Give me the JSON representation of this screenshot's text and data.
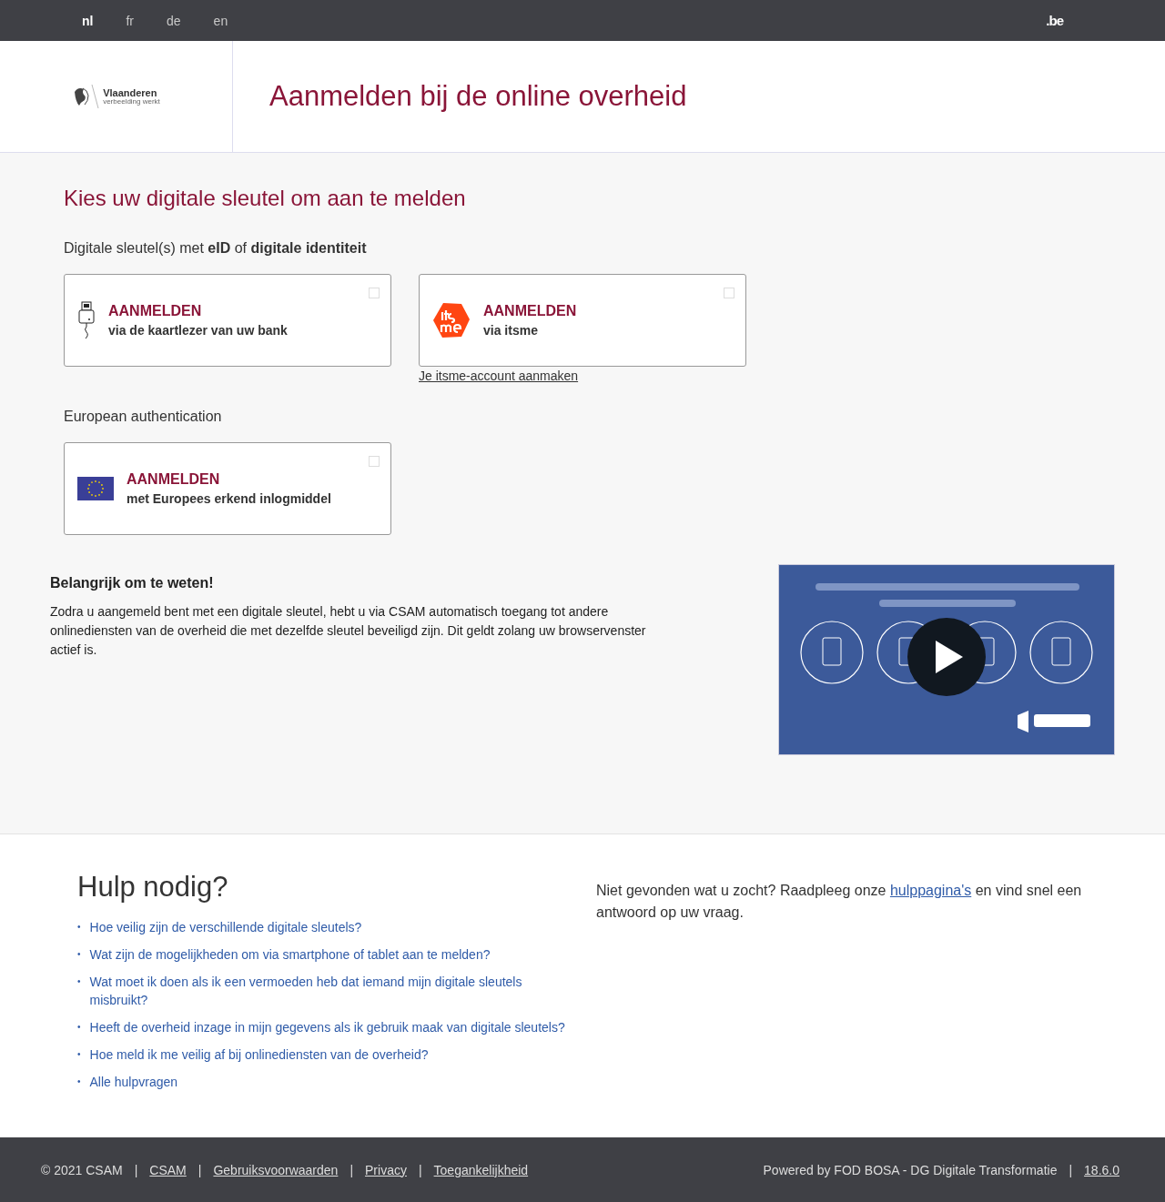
{
  "languages": [
    {
      "label": "nl",
      "selected": true
    },
    {
      "label": "fr",
      "selected": false
    },
    {
      "label": "de",
      "selected": false
    },
    {
      "label": "en",
      "selected": false
    }
  ],
  "domain": ".be",
  "logo": {
    "name": "Vlaanderen",
    "tagline": "verbeelding werkt"
  },
  "page_title": "Aanmelden bij de online overheid",
  "section_title": "Kies uw digitale sleutel om aan te melden",
  "groups": [
    {
      "heading": "Digitale sleutel(s) met **eID** of **digitale identiteit**",
      "options": [
        {
          "kind": "cardreader",
          "title": "AANMELDEN",
          "subtitle": "via de kaartlezer van uw bank",
          "checked": false
        },
        {
          "kind": "itsme",
          "title": "AANMELDEN",
          "subtitle": "via itsme",
          "checked": false,
          "link": "Je itsme-account aanmaken"
        }
      ]
    },
    {
      "heading": "European authentication",
      "options": [
        {
          "kind": "eu",
          "title": "AANMELDEN",
          "subtitle": "met Europees erkend inlogmiddel",
          "checked": false
        }
      ]
    }
  ],
  "info": {
    "title": "Belangrijk om te weten!",
    "text": "Zodra u aangemeld bent met een digitale sleutel, hebt u via CSAM automatisch toegang tot andere onlinediensten van de overheid die met dezelfde sleutel beveiligd zijn. Dit geldt zolang uw browservenster actief is."
  },
  "help": {
    "title": "Hulp nodig?",
    "bullet": "•",
    "questions": [
      "Hoe veilig zijn de verschillende digitale sleutels?",
      "Wat zijn de mogelijkheden om via smartphone of tablet aan te melden?",
      "Wat moet ik doen als ik een vermoeden heb dat iemand mijn digitale sleutels misbruikt?",
      "Heeft de overheid inzage in mijn gegevens als ik gebruik maak van digitale sleutels?",
      "Hoe meld ik me veilig af bij onlinediensten van de overheid?",
      "Alle hulpvragen"
    ],
    "side_before": "Niet gevonden wat u zocht? Raadpleeg onze ",
    "side_link": "hulppagina's",
    "side_after": " en vind snel een antwoord op uw vraag."
  },
  "footer": {
    "copyright": "© 2021 CSAM",
    "separator": "|",
    "links": [
      "CSAM",
      "Gebruiksvoorwaarden",
      "Privacy",
      "Toegankelijkheid"
    ],
    "powered": "Powered by FOD BOSA - DG Digitale Transformatie",
    "version": "18.6.0"
  }
}
